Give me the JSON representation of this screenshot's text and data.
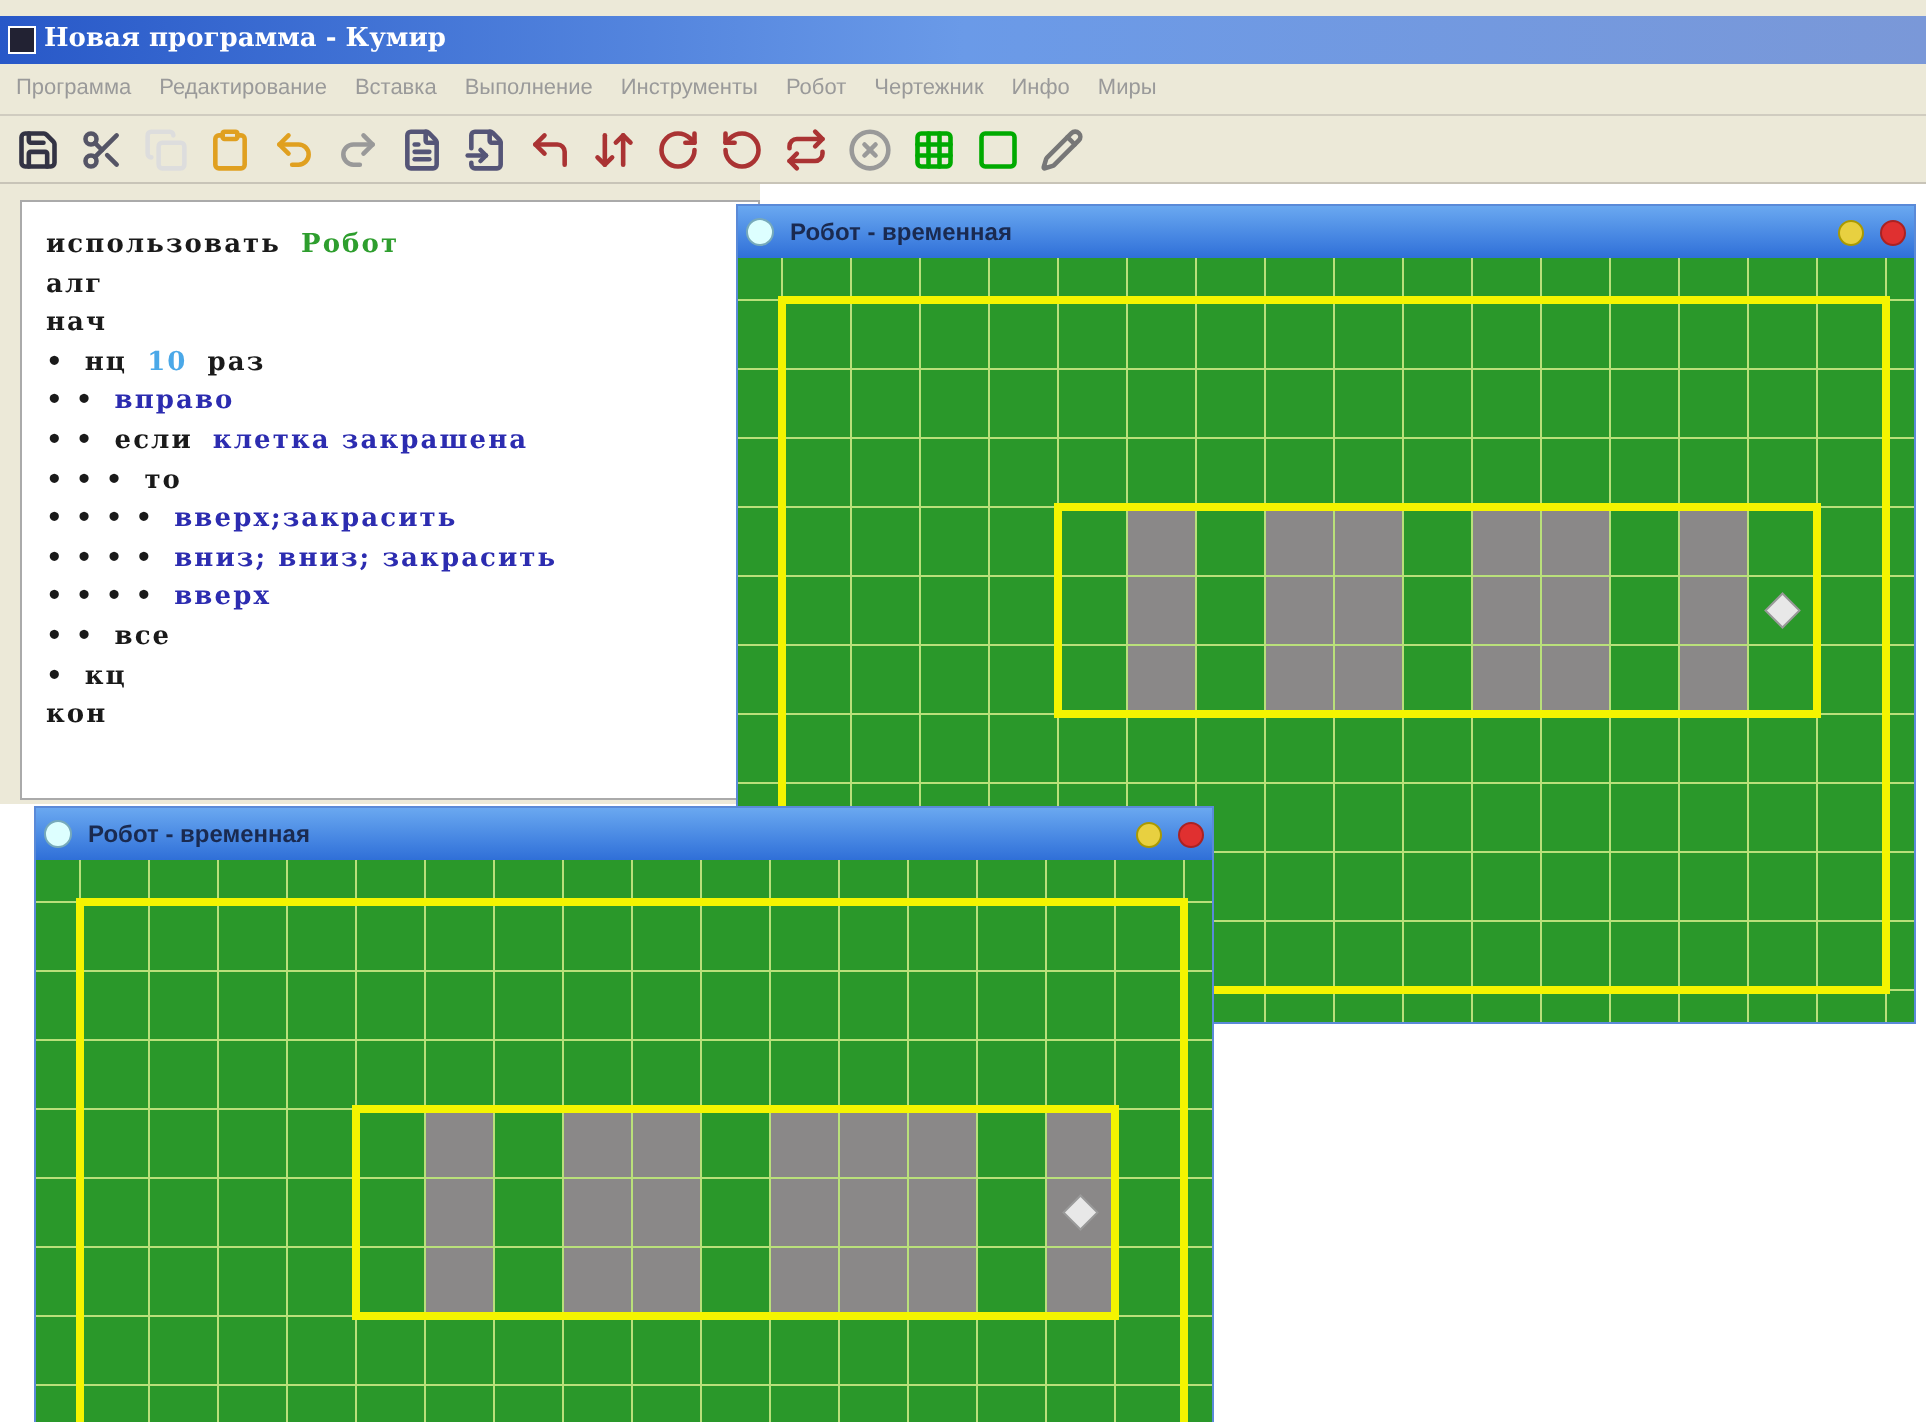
{
  "window": {
    "title": "Новая программа - Кумир"
  },
  "menu": [
    {
      "label": "Программа"
    },
    {
      "label": "Редактирование"
    },
    {
      "label": "Вставка"
    },
    {
      "label": "Выполнение"
    },
    {
      "label": "Инструменты"
    },
    {
      "label": "Робот"
    },
    {
      "label": "Чертежник"
    },
    {
      "label": "Инфо"
    },
    {
      "label": "Миры"
    }
  ],
  "editor": {
    "lines": [
      {
        "segments": [
          {
            "kind": "keyword",
            "text": "использовать"
          },
          {
            "kind": "name",
            "text": "Робот"
          }
        ]
      },
      {
        "segments": [
          {
            "kind": "keyword",
            "text": "алг"
          }
        ]
      },
      {
        "segments": [
          {
            "kind": "keyword",
            "text": "нач"
          }
        ]
      },
      {
        "segments": [
          {
            "kind": "marker",
            "text": "•"
          },
          {
            "kind": "keyword",
            "text": "нц"
          },
          {
            "kind": "number",
            "text": "10"
          },
          {
            "kind": "keyword",
            "text": "раз"
          }
        ]
      },
      {
        "segments": [
          {
            "kind": "marker",
            "text": "• •"
          },
          {
            "kind": "command",
            "text": "вправо"
          }
        ]
      },
      {
        "segments": [
          {
            "kind": "marker",
            "text": "• •"
          },
          {
            "kind": "keyword",
            "text": "если"
          },
          {
            "kind": "command",
            "text": "клетка закрашена"
          }
        ]
      },
      {
        "segments": [
          {
            "kind": "marker",
            "text": "• • •"
          },
          {
            "kind": "keyword",
            "text": "то"
          }
        ]
      },
      {
        "segments": [
          {
            "kind": "marker",
            "text": "• • • •"
          },
          {
            "kind": "command",
            "text": "вверх;закрасить"
          }
        ]
      },
      {
        "segments": [
          {
            "kind": "marker",
            "text": "• • • •"
          },
          {
            "kind": "command",
            "text": "вниз; вниз; закрасить"
          }
        ]
      },
      {
        "segments": [
          {
            "kind": "marker",
            "text": "• • • •"
          },
          {
            "kind": "command",
            "text": "вверх"
          }
        ]
      },
      {
        "segments": [
          {
            "kind": "marker",
            "text": "• •"
          },
          {
            "kind": "keyword",
            "text": "все"
          }
        ]
      },
      {
        "segments": [
          {
            "kind": "marker",
            "text": "•"
          },
          {
            "kind": "keyword",
            "text": "кц"
          }
        ]
      },
      {
        "segments": [
          {
            "kind": "keyword",
            "text": "кон"
          }
        ]
      }
    ]
  },
  "robot_windows": [
    {
      "title": "Робот - временная"
    },
    {
      "title": "Робот - временная"
    }
  ]
}
